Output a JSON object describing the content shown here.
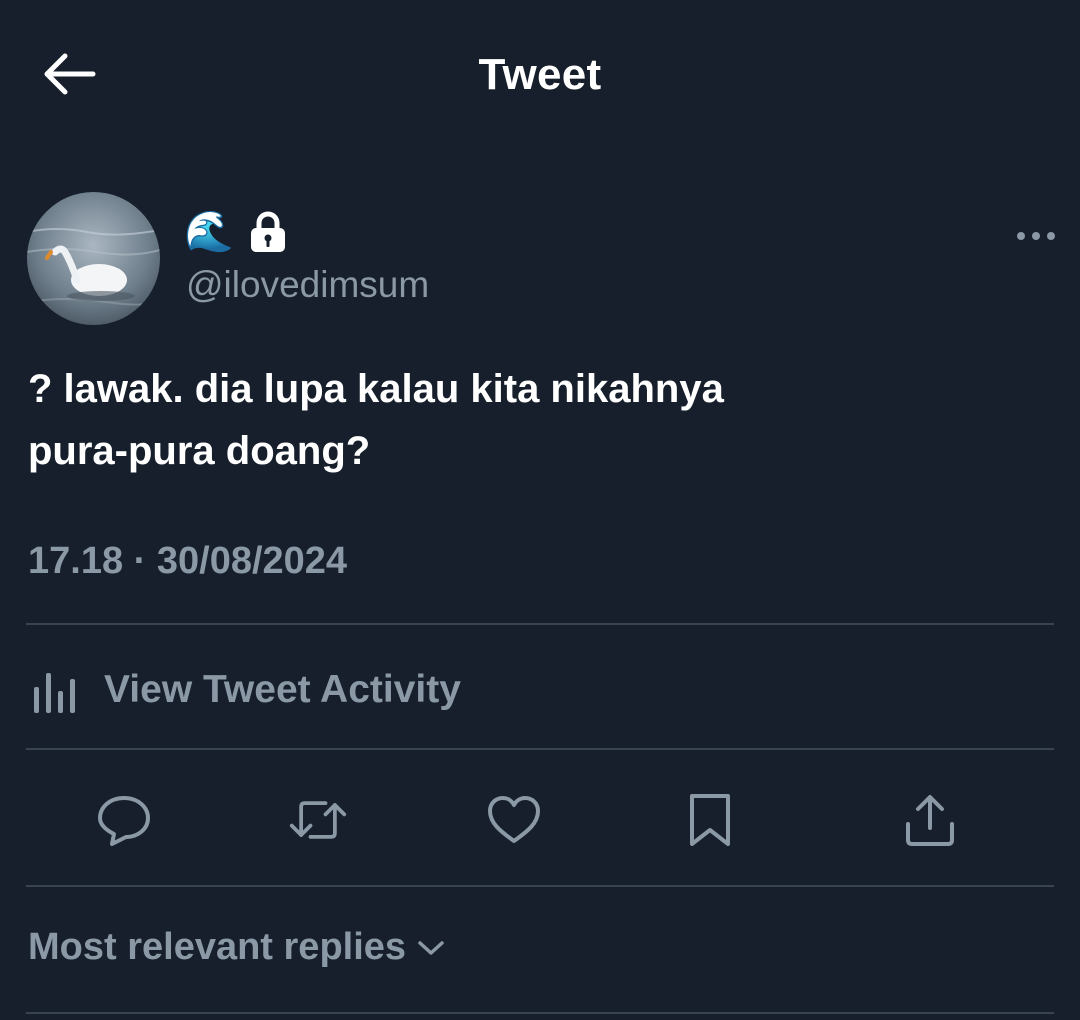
{
  "header": {
    "title": "Tweet",
    "back_icon": "arrow-left-icon"
  },
  "author": {
    "display_name_emoji": "🌊",
    "protected_icon": "lock-icon",
    "handle": "@ilovedimsum",
    "avatar_desc": "swan-avatar"
  },
  "tweet": {
    "lines": [
      "? lawak. dia lupa kalau kita nikahnya",
      "pura-pura doang?"
    ],
    "time": "17.18",
    "separator": " · ",
    "date": "30/08/2024"
  },
  "activity": {
    "label": "View Tweet Activity",
    "icon": "bar-chart-icon"
  },
  "actions": [
    {
      "name": "reply",
      "icon": "speech-bubble-icon"
    },
    {
      "name": "retweet",
      "icon": "retweet-icon"
    },
    {
      "name": "like",
      "icon": "heart-icon"
    },
    {
      "name": "bookmark",
      "icon": "bookmark-icon"
    },
    {
      "name": "share",
      "icon": "share-icon"
    }
  ],
  "replies": {
    "sort_label": "Most relevant replies",
    "icon": "chevron-down-icon"
  },
  "colors": {
    "background": "#161f2b",
    "text_primary": "#ffffff",
    "text_secondary": "#8b98a5",
    "divider": "#38444d"
  }
}
